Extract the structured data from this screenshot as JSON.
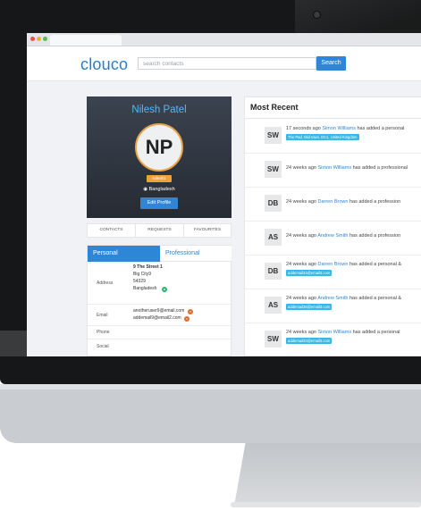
{
  "app": {
    "logo": "clouco"
  },
  "search": {
    "placeholder": "search contacts",
    "button_label": "Search"
  },
  "profile": {
    "name": "Nilesh Patel",
    "initials": "NP",
    "badge": "Nilesh1",
    "location": "Bangladesh",
    "edit_label": "Edit Profile"
  },
  "subtabs": [
    "CONTACTS",
    "REQUESTS",
    "FAVOURITES"
  ],
  "details": {
    "tabs": {
      "personal": "Personal",
      "professional": "Professional"
    },
    "address_label": "Address",
    "address_lines": [
      "9 The Street 1",
      "Big City9",
      "54329",
      "Bangladesh"
    ],
    "email_label": "Email",
    "emails": [
      "anotheruser9@email.com",
      "addemail9@email2.com"
    ],
    "phone_label": "Phone",
    "social_label": "Social"
  },
  "recent": {
    "title": "Most Recent",
    "items": [
      {
        "initials": "SW",
        "time": "17 seconds ago",
        "name": "Simon Williams",
        "action": "has added a personal",
        "tag": "The Pad, Mid town, EC1, United Kingdom"
      },
      {
        "initials": "SW",
        "time": "24 weeks ago",
        "name": "Simon Williams",
        "action": "has added a professional",
        "tag": ""
      },
      {
        "initials": "DB",
        "time": "24 weeks ago",
        "name": "Darren Brown",
        "action": "has added a profession",
        "tag": ""
      },
      {
        "initials": "AS",
        "time": "24 weeks ago",
        "name": "Andrew Smith",
        "action": "has added a profession",
        "tag": ""
      },
      {
        "initials": "DB",
        "time": "24 weeks ago",
        "name": "Darren Brown",
        "action": "has added a personal &",
        "tag": "addemail34@email3.com"
      },
      {
        "initials": "AS",
        "time": "24 weeks ago",
        "name": "Andrew Smith",
        "action": "has added a personal &",
        "tag": "addemail36@email3.com"
      },
      {
        "initials": "SW",
        "time": "24 weeks ago",
        "name": "Simon Williams",
        "action": "has added a personal",
        "tag": "addemail33@email3.com"
      }
    ]
  }
}
